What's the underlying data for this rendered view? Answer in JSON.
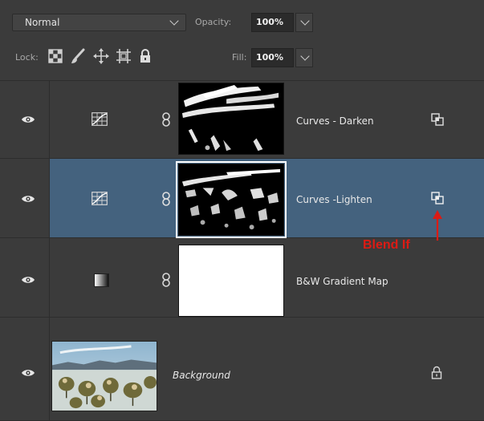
{
  "blend_mode": "Normal",
  "opacity": {
    "label": "Opacity:",
    "value": "100%"
  },
  "lock": {
    "label": "Lock:",
    "icons": [
      "lock-transparent-pixels-icon",
      "lock-image-pixels-icon",
      "lock-position-icon",
      "lock-artboard-icon",
      "lock-all-icon"
    ]
  },
  "fill": {
    "label": "Fill:",
    "value": "100%"
  },
  "layers": [
    {
      "name": "Curves - Darken",
      "type": "curves-adjustment",
      "visible": true,
      "selected": false,
      "badge": "blend-if-icon"
    },
    {
      "name": "Curves -Lighten",
      "type": "curves-adjustment",
      "visible": true,
      "selected": true,
      "badge": "blend-if-icon"
    },
    {
      "name": "B&W Gradient Map",
      "type": "gradient-map-adjustment",
      "visible": true,
      "selected": false
    },
    {
      "name": "Background",
      "type": "image",
      "visible": true,
      "selected": false,
      "locked": true
    }
  ],
  "annotation": {
    "text": "Blend If",
    "color": "#dc1b14"
  },
  "colors": {
    "panel_bg": "#3b3b3b",
    "selected_row": "#44627e",
    "accent_red": "#dc1b14"
  }
}
